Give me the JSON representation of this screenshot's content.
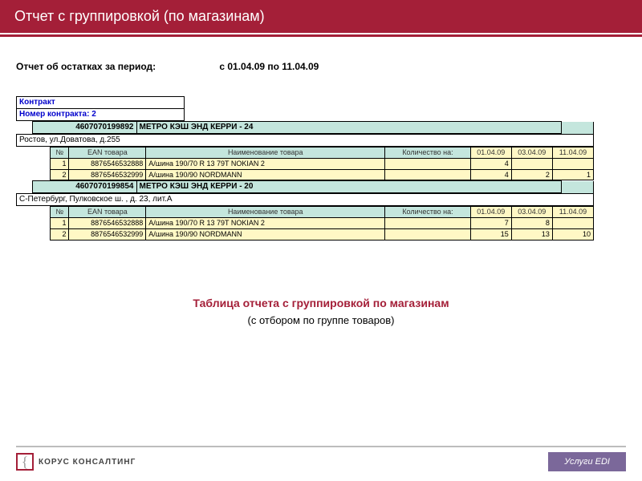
{
  "header": {
    "title": "Отчет с группировкой (по магазинам)"
  },
  "report": {
    "title_label": "Отчет об остатках за период:",
    "period": "с 01.04.09 по 11.04.09"
  },
  "contract": {
    "label": "Контракт",
    "number_label": "Номер контракта: 2"
  },
  "columns": {
    "no": "№",
    "ean": "EAN товара",
    "name": "Наименование товара",
    "qty": "Количество на:",
    "d1": "01.04.09",
    "d2": "03.04.09",
    "d3": "11.04.09"
  },
  "stores": [
    {
      "code": "4607070199892",
      "name": "МЕТРО КЭШ ЭНД КЕРРИ - 24",
      "address": "Ростов, ул.Доватова, д.255",
      "rows": [
        {
          "no": "1",
          "ean": "8876546532888",
          "name": "А/шина 190/70 R 13 79T NOKIAN 2",
          "d1": "4",
          "d2": "",
          "d3": ""
        },
        {
          "no": "2",
          "ean": "8876546532999",
          "name": "А/шина 190/90 NORDMANN",
          "d1": "4",
          "d2": "2",
          "d3": "1"
        }
      ]
    },
    {
      "code": "4607070199854",
      "name": "МЕТРО КЭШ ЭНД КЕРРИ - 20",
      "address": "С-Петербург, Пулковское ш. , д. 23, лит.А",
      "rows": [
        {
          "no": "1",
          "ean": "8876546532888",
          "name": "А/шина 190/70 R 13 79T NOKIAN 2",
          "d1": "7",
          "d2": "8",
          "d3": ""
        },
        {
          "no": "2",
          "ean": "8876546532999",
          "name": "А/шина 190/90 NORDMANN",
          "d1": "15",
          "d2": "13",
          "d3": "10"
        }
      ]
    }
  ],
  "caption": {
    "main": "Таблица отчета с группировкой по магазинам",
    "sub": "(с отбором по группе товаров)"
  },
  "footer": {
    "logo_text": "КОРУС КОНСАЛТИНГ",
    "edi": "Услуги EDI"
  }
}
